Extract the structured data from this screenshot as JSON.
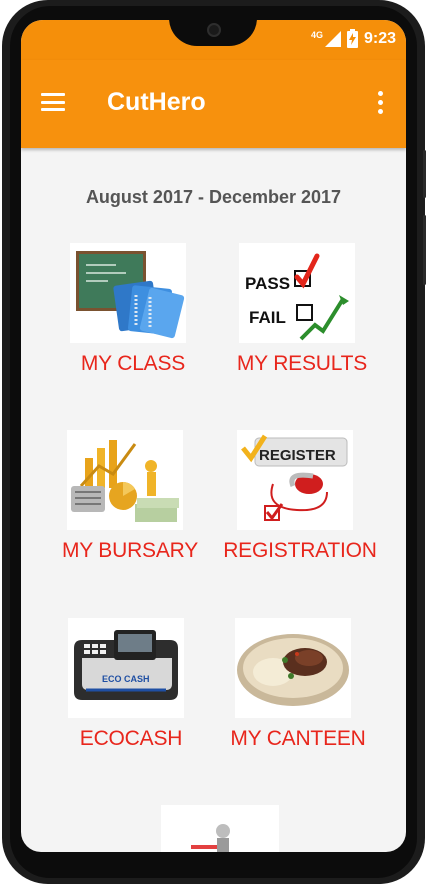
{
  "status_bar": {
    "network": "4G",
    "time": "9:23"
  },
  "app_bar": {
    "title": "CutHero"
  },
  "main": {
    "period": "August 2017 - December 2017",
    "tiles": [
      {
        "label": "MY CLASS",
        "icon": "classroom-books-icon"
      },
      {
        "label": "MY RESULTS",
        "icon": "pass-fail-icon"
      },
      {
        "label": "MY BURSARY",
        "icon": "finance-chart-icon"
      },
      {
        "label": "REGISTRATION",
        "icon": "register-checklist-icon"
      },
      {
        "label": "ECOCASH",
        "icon": "ecocash-terminal-icon"
      },
      {
        "label": "MY CANTEEN",
        "icon": "food-plate-icon"
      }
    ]
  },
  "images_text": {
    "pass": "PASS",
    "fail": "FAIL",
    "register": "REGISTER",
    "ecocash": "ECO CASH"
  },
  "colors": {
    "primary": "#f7910d",
    "label_red": "#e8261c",
    "subtitle_grey": "#555555"
  }
}
